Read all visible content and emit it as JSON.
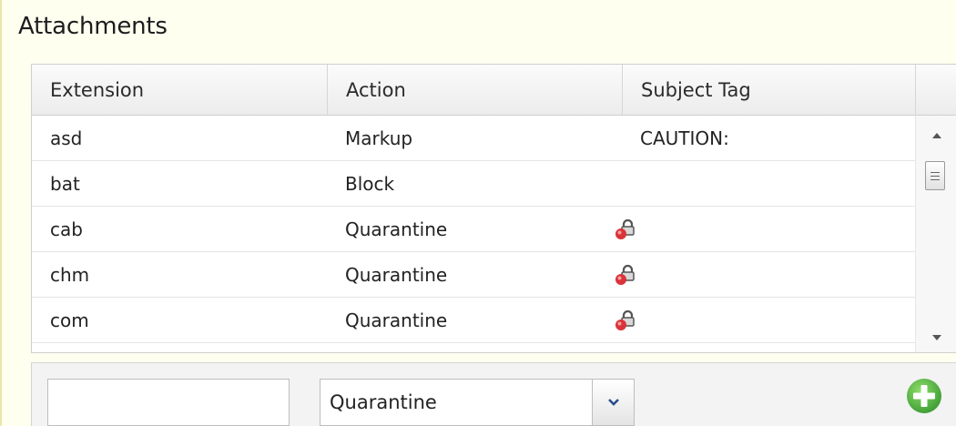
{
  "panel": {
    "title": "Attachments"
  },
  "grid": {
    "columns": [
      {
        "label": "Extension"
      },
      {
        "label": "Action"
      },
      {
        "label": "Subject Tag"
      }
    ],
    "rows": [
      {
        "extension": "asd",
        "action": "Markup",
        "subject_tag": "CAUTION:",
        "locked": false
      },
      {
        "extension": "bat",
        "action": "Block",
        "subject_tag": "",
        "locked": false
      },
      {
        "extension": "cab",
        "action": "Quarantine",
        "subject_tag": "",
        "locked": true
      },
      {
        "extension": "chm",
        "action": "Quarantine",
        "subject_tag": "",
        "locked": true
      },
      {
        "extension": "com",
        "action": "Quarantine",
        "subject_tag": "",
        "locked": true
      }
    ]
  },
  "footer": {
    "extension_value": "",
    "action_value": "Quarantine"
  },
  "colors": {
    "panel_bg": "#fffff0",
    "add_green": "#4cb848",
    "lock_red": "#d9343a"
  },
  "icons": {
    "lock": "lock-icon",
    "add": "add-icon",
    "dropdown": "chevron-down-icon"
  }
}
